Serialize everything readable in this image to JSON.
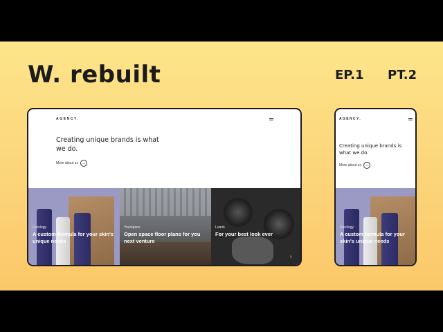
{
  "header": {
    "title": "W.  rebuilt",
    "episode": "EP.1",
    "part": "PT.2"
  },
  "desktop": {
    "logo": "AGENCY.",
    "hero": "Creating unique brands is what we do.",
    "more_label": "More about us",
    "more_arrow": "→",
    "tiles": [
      {
        "brand": "Curology",
        "caption": "A custom formula for your skin's unique needs"
      },
      {
        "brand": "Yourspace",
        "caption": "Open space floor plans for you next venture"
      },
      {
        "brand": "Lumin",
        "caption": "For your best look ever"
      }
    ],
    "next_arrow": "›"
  },
  "mobile": {
    "logo": "AGENCY.",
    "hero": "Creating unique brands is what we do.",
    "more_label": "More about us",
    "more_arrow": "→",
    "tile": {
      "brand": "Curology",
      "caption": "A custom formula for your skin's unique needs"
    }
  }
}
